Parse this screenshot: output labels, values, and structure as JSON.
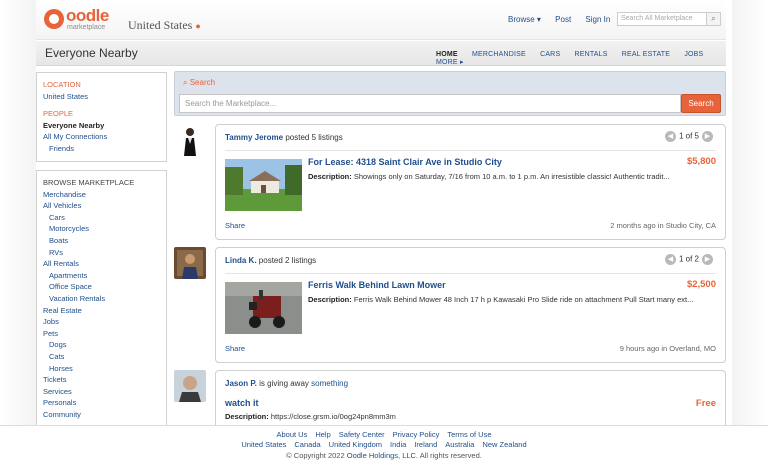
{
  "header": {
    "logo_text": "oodle",
    "logo_sub": "marketplace",
    "country": "United States",
    "nav": [
      "Browse ▾",
      "Post",
      "Sign In"
    ],
    "search_placeholder": "Search All Marketplace"
  },
  "subheader": {
    "title": "Everyone Nearby",
    "categories": [
      "HOME",
      "MERCHANDISE",
      "CARS",
      "RENTALS",
      "REAL ESTATE",
      "JOBS",
      "MORE ▸"
    ]
  },
  "sidebar": {
    "location_head": "LOCATION",
    "location": "United States",
    "people_head": "PEOPLE",
    "people_selected": "Everyone Nearby",
    "people_items": [
      "All My Connections",
      "Friends"
    ],
    "browse_head": "BROWSE MARKETPLACE",
    "browse": [
      {
        "label": "Merchandise",
        "level": 0
      },
      {
        "label": "All Vehicles",
        "level": 0
      },
      {
        "label": "Cars",
        "level": 1
      },
      {
        "label": "Motorcycles",
        "level": 1
      },
      {
        "label": "Boats",
        "level": 1
      },
      {
        "label": "RVs",
        "level": 1
      },
      {
        "label": "All Rentals",
        "level": 0
      },
      {
        "label": "Apartments",
        "level": 1
      },
      {
        "label": "Office Space",
        "level": 1
      },
      {
        "label": "Vacation Rentals",
        "level": 1
      },
      {
        "label": "Real Estate",
        "level": 0
      },
      {
        "label": "Jobs",
        "level": 0
      },
      {
        "label": "Pets",
        "level": 0
      },
      {
        "label": "Dogs",
        "level": 1
      },
      {
        "label": "Cats",
        "level": 1
      },
      {
        "label": "Horses",
        "level": 1
      },
      {
        "label": "Tickets",
        "level": 0
      },
      {
        "label": "Services",
        "level": 0
      },
      {
        "label": "Personals",
        "level": 0
      },
      {
        "label": "Community",
        "level": 0
      }
    ]
  },
  "search": {
    "label": "Search",
    "placeholder": "Search the Marketplace...",
    "button": "Search"
  },
  "feed": [
    {
      "poster": "Tammy Jerome",
      "action": "posted 5 listings",
      "pager": "1 of 5",
      "title": "For Lease: 4318 Saint Clair Ave in Studio City",
      "price": "$5,800",
      "desc_label": "Description:",
      "desc": "Showings only on Saturday, 7/16 from 10 a.m. to 1 p.m. An irresistible classic! Authentic tradit...",
      "share": "Share",
      "when": "2 months ago in Studio City, CA"
    },
    {
      "poster": "Linda K.",
      "action": "posted 2 listings",
      "pager": "1 of 2",
      "title": "Ferris Walk Behind Lawn Mower",
      "price": "$2,500",
      "desc_label": "Description:",
      "desc": "Ferris Walk Behind Mower 48 Inch 17 h p Kawasaki Pro Slide ride on attachment Pull Start many ext...",
      "share": "Share",
      "when": "9 hours ago in Overland, MO"
    },
    {
      "poster": "Jason P.",
      "action": "is giving away",
      "thing": "something",
      "title": "watch it",
      "price": "Free",
      "desc_label": "Description:",
      "desc": "https://close.grsm.io/0og24pn8mm3m"
    }
  ],
  "footer": {
    "links": [
      "About Us",
      "Help",
      "Safety Center",
      "Privacy Policy",
      "Terms of Use"
    ],
    "countries": [
      "United States",
      "Canada",
      "United Kingdom",
      "India",
      "Ireland",
      "Australia",
      "New Zealand"
    ],
    "copyright_prefix": "© Copyright 2022",
    "company": "Oodle Holdings, LLC.",
    "copyright_suffix": "All rights reserved."
  },
  "colors": {
    "accent": "#e8633a",
    "link": "#1f4e8c"
  }
}
